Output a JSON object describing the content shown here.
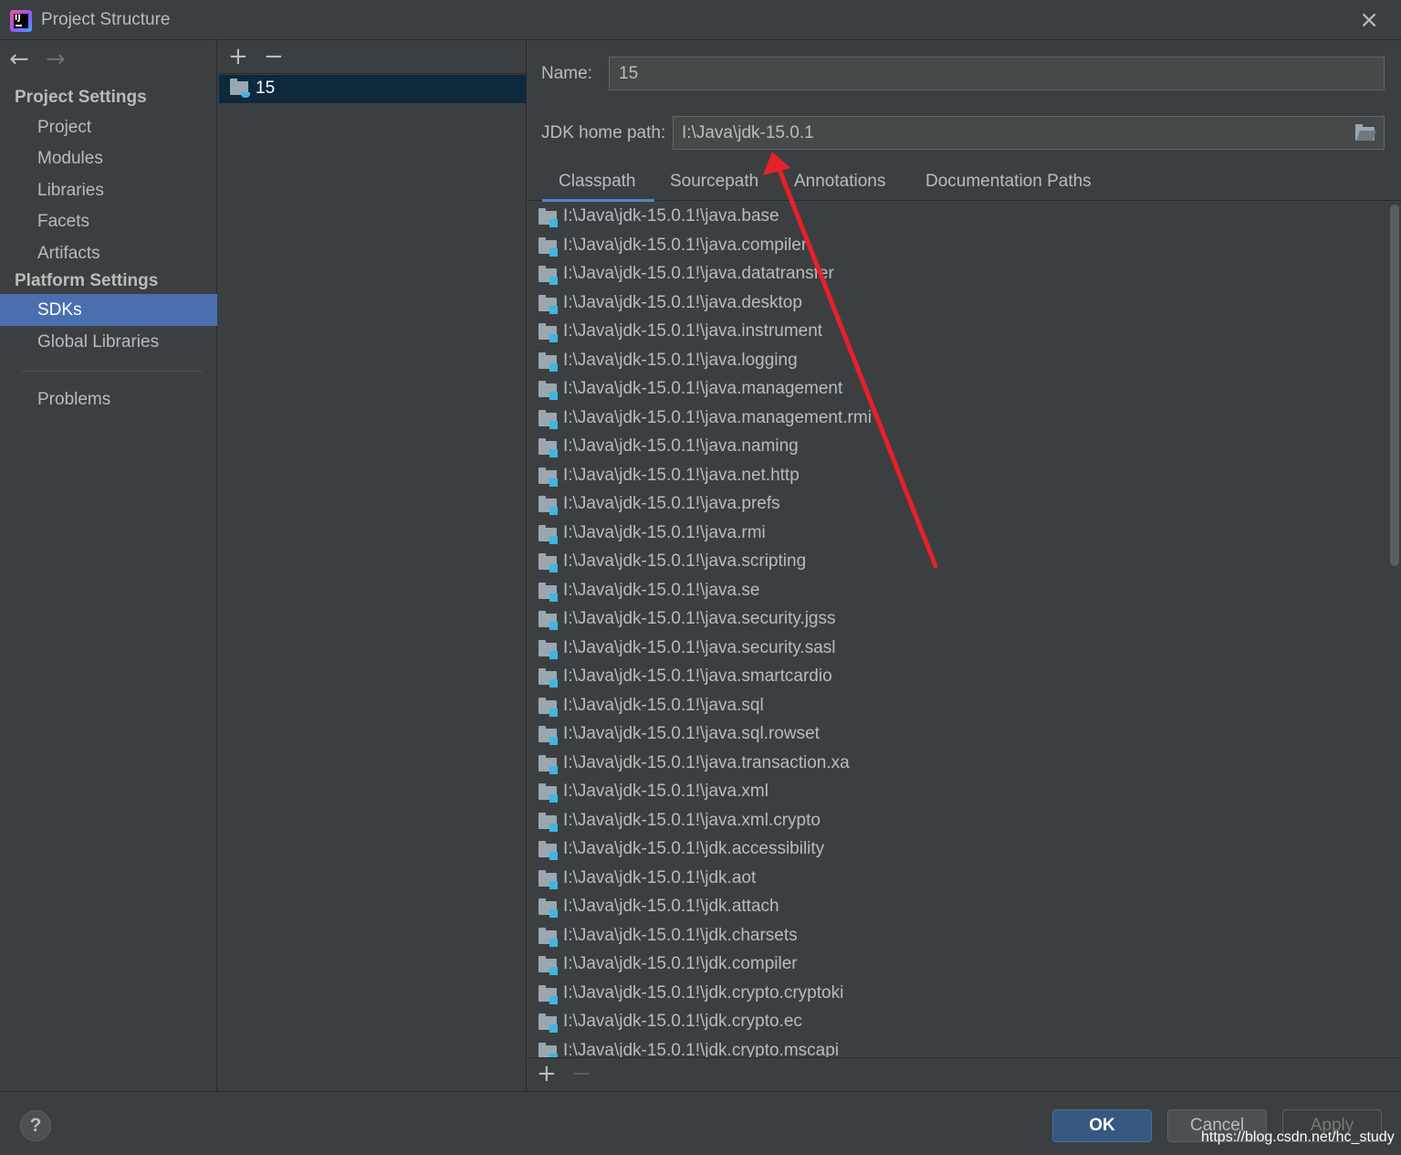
{
  "window": {
    "title": "Project Structure",
    "close_glyph": "×"
  },
  "sidebar": {
    "back_glyph": "←",
    "forward_glyph": "→",
    "project_settings_header": "Project Settings",
    "project_items": [
      {
        "label": "Project"
      },
      {
        "label": "Modules"
      },
      {
        "label": "Libraries"
      },
      {
        "label": "Facets"
      },
      {
        "label": "Artifacts"
      }
    ],
    "platform_settings_header": "Platform Settings",
    "platform_items": [
      {
        "label": "SDKs",
        "selected": true
      },
      {
        "label": "Global Libraries"
      }
    ],
    "problems_label": "Problems"
  },
  "sdk_list": {
    "add_glyph": "+",
    "remove_glyph": "−",
    "items": [
      {
        "label": "15",
        "selected": true
      }
    ]
  },
  "sdk_detail": {
    "name_label": "Name:",
    "name_value": "15",
    "jdk_home_label": "JDK home path:",
    "jdk_home_value": "I:\\Java\\jdk-15.0.1",
    "tabs": [
      {
        "label": "Classpath",
        "active": true
      },
      {
        "label": "Sourcepath"
      },
      {
        "label": "Annotations"
      },
      {
        "label": "Documentation Paths"
      }
    ],
    "classpath_entries": [
      "I:\\Java\\jdk-15.0.1!\\java.base",
      "I:\\Java\\jdk-15.0.1!\\java.compiler",
      "I:\\Java\\jdk-15.0.1!\\java.datatransfer",
      "I:\\Java\\jdk-15.0.1!\\java.desktop",
      "I:\\Java\\jdk-15.0.1!\\java.instrument",
      "I:\\Java\\jdk-15.0.1!\\java.logging",
      "I:\\Java\\jdk-15.0.1!\\java.management",
      "I:\\Java\\jdk-15.0.1!\\java.management.rmi",
      "I:\\Java\\jdk-15.0.1!\\java.naming",
      "I:\\Java\\jdk-15.0.1!\\java.net.http",
      "I:\\Java\\jdk-15.0.1!\\java.prefs",
      "I:\\Java\\jdk-15.0.1!\\java.rmi",
      "I:\\Java\\jdk-15.0.1!\\java.scripting",
      "I:\\Java\\jdk-15.0.1!\\java.se",
      "I:\\Java\\jdk-15.0.1!\\java.security.jgss",
      "I:\\Java\\jdk-15.0.1!\\java.security.sasl",
      "I:\\Java\\jdk-15.0.1!\\java.smartcardio",
      "I:\\Java\\jdk-15.0.1!\\java.sql",
      "I:\\Java\\jdk-15.0.1!\\java.sql.rowset",
      "I:\\Java\\jdk-15.0.1!\\java.transaction.xa",
      "I:\\Java\\jdk-15.0.1!\\java.xml",
      "I:\\Java\\jdk-15.0.1!\\java.xml.crypto",
      "I:\\Java\\jdk-15.0.1!\\jdk.accessibility",
      "I:\\Java\\jdk-15.0.1!\\jdk.aot",
      "I:\\Java\\jdk-15.0.1!\\jdk.attach",
      "I:\\Java\\jdk-15.0.1!\\jdk.charsets",
      "I:\\Java\\jdk-15.0.1!\\jdk.compiler",
      "I:\\Java\\jdk-15.0.1!\\jdk.crypto.cryptoki",
      "I:\\Java\\jdk-15.0.1!\\jdk.crypto.ec",
      "I:\\Java\\jdk-15.0.1!\\jdk.crypto.mscapi"
    ],
    "add_glyph": "+",
    "remove_glyph": "−"
  },
  "footer": {
    "help_glyph": "?",
    "ok_label": "OK",
    "cancel_label": "Cancel",
    "apply_label": "Apply",
    "watermark": "https://blog.csdn.net/hc_study"
  },
  "colors": {
    "background": "#3c3f41",
    "selection": "#4b6eaf",
    "list_selection": "#0d293e",
    "primary_button": "#365880",
    "tab_underline": "#4a88c7",
    "annotation_arrow": "#e8202a"
  },
  "icons": {
    "app_logo": "intellij-idea-icon",
    "folder": "folder-icon",
    "sdk": "jdk-folder-icon",
    "browse": "open-folder-icon"
  }
}
